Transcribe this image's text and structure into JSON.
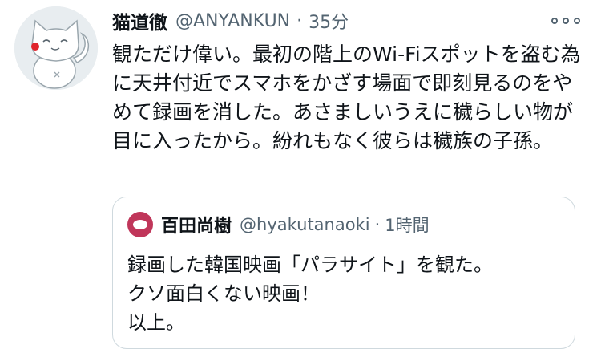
{
  "tweet": {
    "display_name": "猫道徹",
    "handle": "@ANYANKUN",
    "separator": "·",
    "time": "35分",
    "more_icon": "more-horizontal-icon",
    "text": "観ただけ偉い。最初の階上のWi-Fiスポットを盗む為に天井付近でスマホをかざす場面で即刻見るのをやめて録画を消した。あさましいうえに穢らしい物が目に入ったから。紛れもなく彼らは穢族の子孫。"
  },
  "quoted_tweet": {
    "display_name": "百田尚樹",
    "handle": "@hyakutanaoki",
    "separator": "·",
    "time": "1時間",
    "lines": [
      "録画した韓国映画「パラサイト」を観た。",
      "クソ面白くない映画！",
      "以上。"
    ]
  }
}
